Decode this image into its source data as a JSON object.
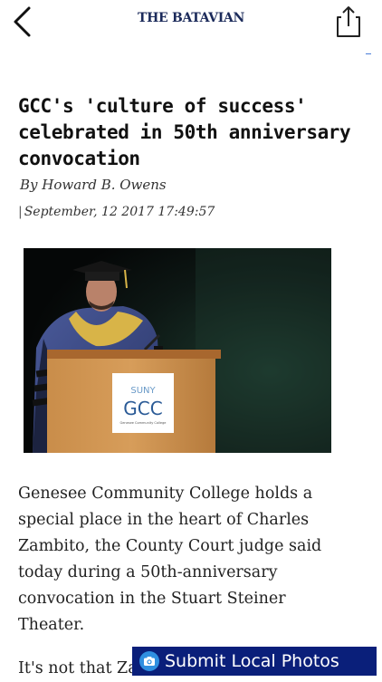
{
  "header": {
    "back_icon": "chevron-left-icon",
    "masthead": "THE BATAVIAN",
    "share_icon": "share-icon"
  },
  "article": {
    "title": "GCC's 'culture of success' celebrated in 50th anniversary convocation",
    "byline": "By Howard B. Owens",
    "date_separator": "|",
    "date": "September, 12 2017 17:49:57",
    "photo": {
      "lectern_logo_top": "SUNY",
      "lectern_logo_main": "GCC",
      "lectern_logo_sub": "Genesee Community College"
    },
    "paragraph_1": "Genesee Community College holds a special place in the heart of Charles Zambito, the County Court judge said today during a 50th-anniversary convocation in the Stuart Steiner Theater.",
    "paragraph_2_partial": "It's not that Zambito, who also"
  },
  "submit_button": {
    "icon": "camera-icon",
    "label": "Submit Local Photos",
    "color": "#0a1f7a"
  }
}
